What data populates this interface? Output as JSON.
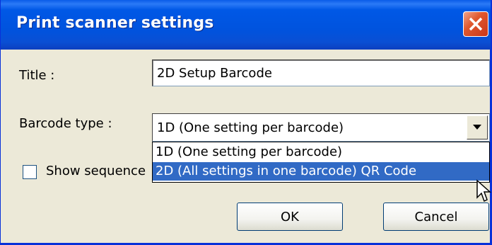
{
  "window": {
    "title": "Print scanner settings"
  },
  "title_field": {
    "label": "Title :",
    "value": "2D Setup Barcode"
  },
  "barcode_type": {
    "label": "Barcode type :",
    "selected": "1D (One setting per barcode)",
    "options": [
      "1D (One setting per barcode)",
      "2D (All settings in one barcode) QR Code"
    ],
    "highlighted_index": 1
  },
  "show_sequence": {
    "label": "Show sequence",
    "checked": false
  },
  "buttons": {
    "ok": "OK",
    "cancel": "Cancel"
  },
  "colors": {
    "titlebar": "#0053de",
    "selection": "#316ac5",
    "face": "#ece9d8"
  }
}
